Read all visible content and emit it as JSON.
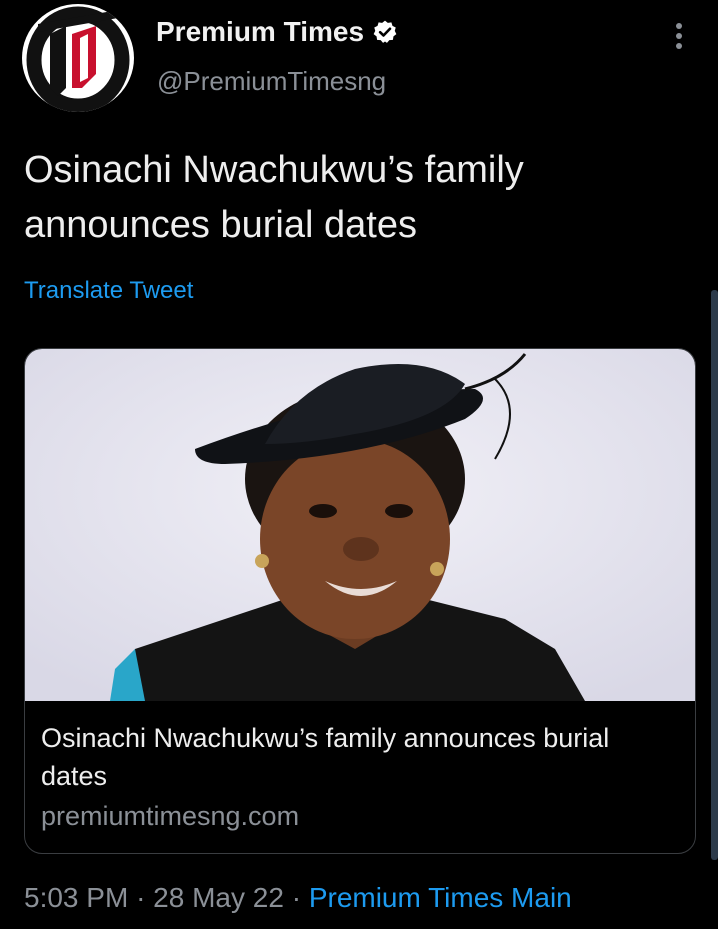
{
  "tweet": {
    "author": {
      "display_name": "Premium Times",
      "handle": "@PremiumTimesng",
      "verified": true,
      "avatar_icon": "premium-times-logo"
    },
    "text": "Osinachi Nwachukwu’s family announces burial dates",
    "translate_label": "Translate Tweet",
    "card": {
      "title": "Osinachi Nwachukwu’s family announces burial dates",
      "domain": "premiumtimesng.com"
    },
    "meta": {
      "time": "5:03 PM",
      "separator": "·",
      "date": "28 May 22",
      "source": "Premium Times Main"
    }
  },
  "colors": {
    "background": "#000000",
    "link": "#1d9bf0",
    "muted": "#8b9097",
    "text": "#eeeeee",
    "logo_red": "#c8102e"
  }
}
